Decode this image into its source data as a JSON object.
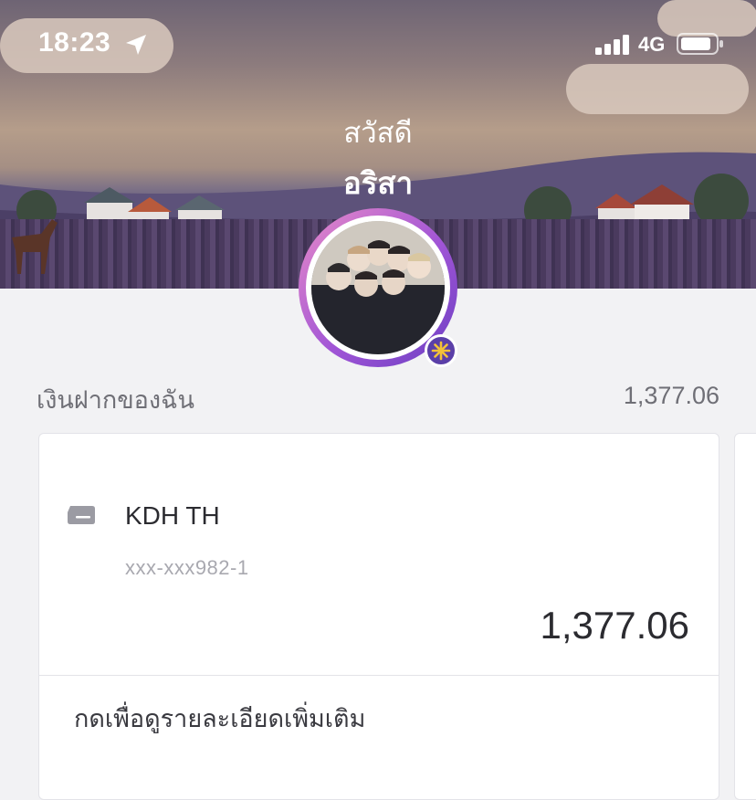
{
  "status_bar": {
    "time": "18:23",
    "network": "4G",
    "icons": [
      "location-arrow-icon",
      "signal-bars-icon",
      "battery-icon"
    ]
  },
  "header": {
    "greeting": "สวัสดี",
    "user_name": "อริสา",
    "avatar_badge_icon": "sparkle-icon"
  },
  "deposits": {
    "label": "เงินฝากของฉัน",
    "total": "1,377.06"
  },
  "account_card": {
    "icon": "card-icon",
    "bank_name": "KDH TH",
    "account_number": "xxx-xxx982-1",
    "balance": "1,377.06",
    "details_link": "กดเพื่อดูรายละเอียดเพิ่มเติม"
  },
  "colors": {
    "accent": "#6a3ec2",
    "ring_start": "#e88bc8",
    "background": "#f2f2f4"
  }
}
